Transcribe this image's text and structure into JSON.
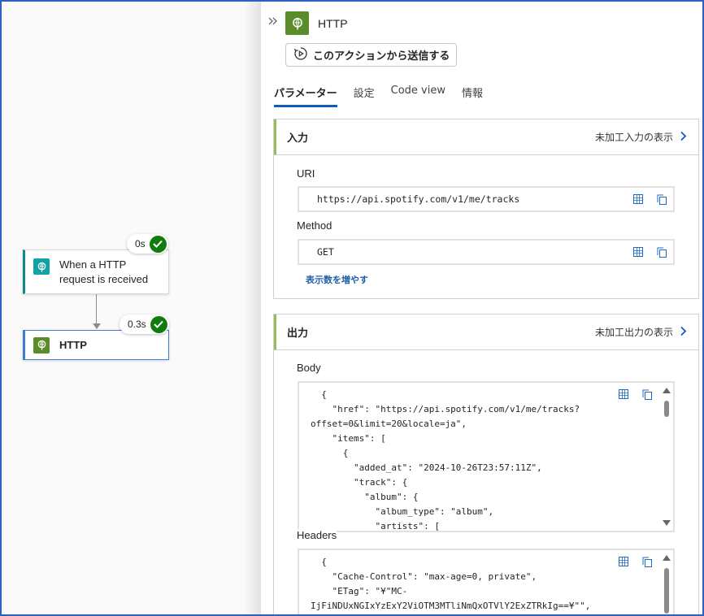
{
  "canvas": {
    "trigger_node": {
      "label": "When a HTTP request is received",
      "duration": "0s"
    },
    "http_node": {
      "label": "HTTP",
      "duration": "0.3s"
    }
  },
  "panel": {
    "title": "HTTP",
    "send_button": "このアクションから送信する",
    "tabs": [
      {
        "label": "パラメーター",
        "active": true
      },
      {
        "label": "設定",
        "active": false
      },
      {
        "label": "Code view",
        "active": false
      },
      {
        "label": "情報",
        "active": false
      }
    ],
    "input": {
      "title": "入力",
      "raw_link": "未加工入力の表示",
      "uri_label": "URI",
      "uri_value": "https://api.spotify.com/v1/me/tracks",
      "method_label": "Method",
      "method_value": "GET",
      "more_link": "表示数を増やす"
    },
    "output": {
      "title": "出力",
      "raw_link": "未加工出力の表示",
      "body_label": "Body",
      "body_code": "  {\n    \"href\": \"https://api.spotify.com/v1/me/tracks?\noffset=0&limit=20&locale=ja\",\n    \"items\": [\n      {\n        \"added_at\": \"2024-10-26T23:57:11Z\",\n        \"track\": {\n          \"album\": {\n            \"album_type\": \"album\",\n            \"artists\": [",
      "headers_label": "Headers",
      "headers_code": "  {\n    \"Cache-Control\": \"max-age=0, private\",\n    \"ETag\": \"¥\"MC-\nIjFiNDUxNGIxYzExY2ViOTM3MTliNmQxOTVlY2ExZTRkIg==¥\"\","
    }
  },
  "colors": {
    "accent_blue": "#0f5cbf",
    "success_green": "#107c10",
    "http_icon": "#5b8c2a",
    "trigger_icon": "#10a3a3",
    "section_accent": "#9bbb59"
  }
}
